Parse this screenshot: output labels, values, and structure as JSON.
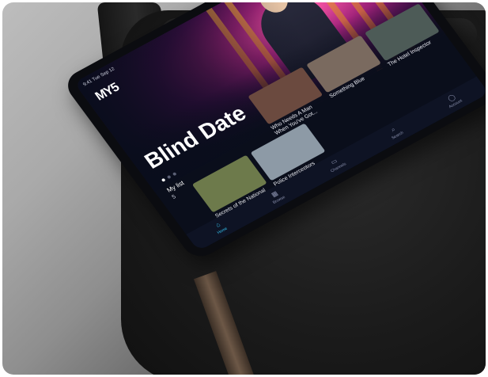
{
  "scene": {
    "colors": {
      "background": "#a9a9a9",
      "chair": "#1b1b1b",
      "tablet_bezel": "#0b0c10",
      "accent": "#35c6f4"
    }
  },
  "app": {
    "status_bar": "9:41 Tue Sep 12",
    "logo": "MY5",
    "hero": {
      "title": "Blind Date",
      "page_dots": 3,
      "active_dot": 0
    },
    "top_row": [
      {
        "title": "Who Needs A Man When You've Got...",
        "color": "#6b4a3f"
      },
      {
        "title": "Something Blue",
        "color": "#7a6a5f"
      },
      {
        "title": "The Hotel Inspector",
        "color": "#4d5b57"
      }
    ],
    "my_list": {
      "label": "My list",
      "count": "5"
    },
    "bottom_row": [
      {
        "title": "Secrets of the National Trust with Alan Titchmarsh",
        "color": "#6d7a4b"
      },
      {
        "title": "Police Interceptors",
        "color": "#8d9aa6"
      }
    ],
    "nav": [
      {
        "label": "Home",
        "icon": "home-icon",
        "glyph": "⌂",
        "active": true
      },
      {
        "label": "Browse",
        "icon": "grid-icon",
        "glyph": "▦",
        "active": false
      },
      {
        "label": "Channels",
        "icon": "tv-icon",
        "glyph": "▭",
        "active": false
      },
      {
        "label": "Search",
        "icon": "search-icon",
        "glyph": "⌕",
        "active": false
      },
      {
        "label": "Account",
        "icon": "account-icon",
        "glyph": "◯",
        "active": false
      }
    ]
  }
}
